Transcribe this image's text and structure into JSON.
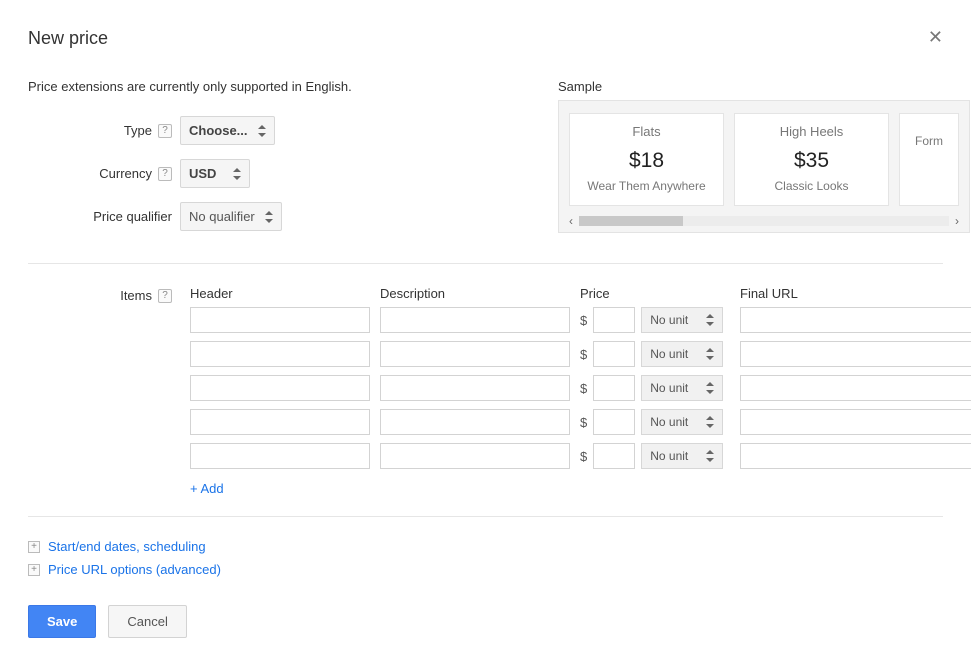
{
  "title": "New price",
  "notice": "Price extensions are currently only supported in English.",
  "form": {
    "type_label": "Type",
    "type_value": "Choose...",
    "currency_label": "Currency",
    "currency_value": "USD",
    "qualifier_label": "Price qualifier",
    "qualifier_value": "No qualifier"
  },
  "sample": {
    "title": "Sample",
    "cards": [
      {
        "title": "Flats",
        "price": "$18",
        "sub": "Wear Them Anywhere"
      },
      {
        "title": "High Heels",
        "price": "$35",
        "sub": "Classic Looks"
      },
      {
        "title": "",
        "price": "",
        "sub": "Form"
      }
    ]
  },
  "items": {
    "label": "Items",
    "cols": {
      "header": "Header",
      "description": "Description",
      "price": "Price",
      "final_url": "Final URL"
    },
    "currency_symbol": "$",
    "unit_value": "No unit",
    "row_count": 5,
    "add_label": "+ Add"
  },
  "expanders": {
    "scheduling": "Start/end dates, scheduling",
    "url_options": "Price URL options (advanced)"
  },
  "buttons": {
    "save": "Save",
    "cancel": "Cancel"
  }
}
